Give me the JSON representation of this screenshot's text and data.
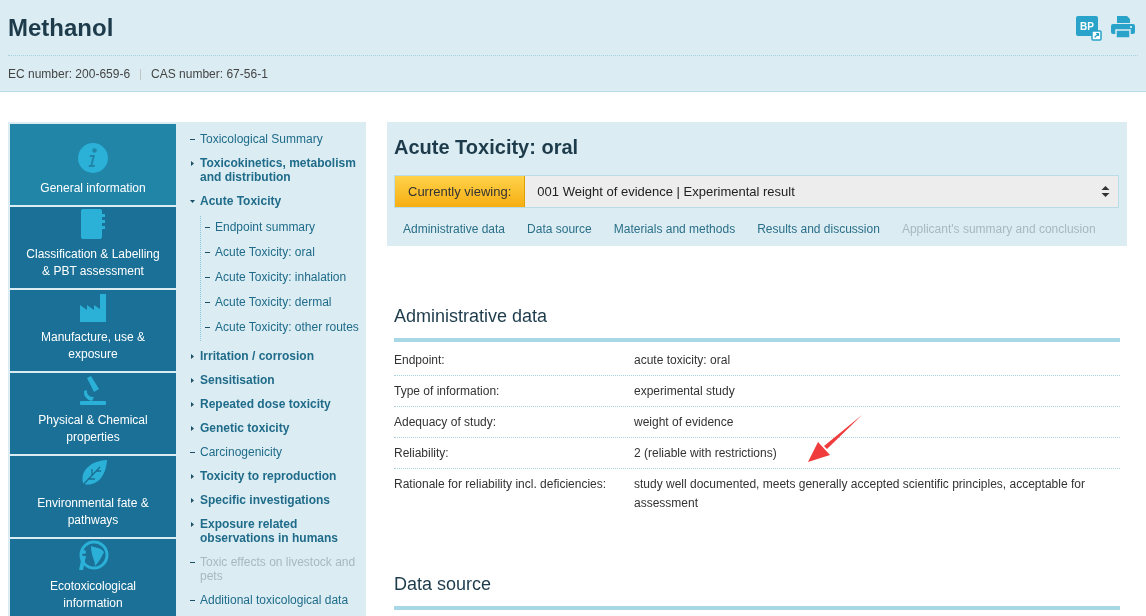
{
  "header": {
    "title": "Methanol",
    "export_badge": "BP",
    "identifiers": [
      {
        "text": "EC number: 200-659-6"
      },
      {
        "text": "CAS number: 67-56-1"
      }
    ]
  },
  "categories": [
    {
      "label": "General information",
      "selected": true
    },
    {
      "label": "Classification & Labelling & PBT assessment",
      "selected": false
    },
    {
      "label": "Manufacture, use & exposure",
      "selected": false
    },
    {
      "label": "Physical & Chemical properties",
      "selected": false
    },
    {
      "label": "Environmental fate & pathways",
      "selected": false
    },
    {
      "label": "Ecotoxicological information",
      "selected": false
    }
  ],
  "tree": [
    {
      "label": "Toxicological Summary",
      "kind": "leaf",
      "disabled": false
    },
    {
      "label": "Toxicokinetics, metabolism and distribution",
      "kind": "branch",
      "expanded": false
    },
    {
      "label": "Acute Toxicity",
      "kind": "branch",
      "expanded": true,
      "children": [
        {
          "label": "Endpoint summary",
          "kind": "leaf",
          "disabled": false
        },
        {
          "label": "Acute Toxicity: oral",
          "kind": "leaf",
          "disabled": false
        },
        {
          "label": "Acute Toxicity: inhalation",
          "kind": "leaf",
          "disabled": false
        },
        {
          "label": "Acute Toxicity: dermal",
          "kind": "leaf",
          "disabled": false
        },
        {
          "label": "Acute Toxicity: other routes",
          "kind": "leaf",
          "disabled": false
        }
      ]
    },
    {
      "label": "Irritation / corrosion",
      "kind": "branch",
      "expanded": false
    },
    {
      "label": "Sensitisation",
      "kind": "branch",
      "expanded": false
    },
    {
      "label": "Repeated dose toxicity",
      "kind": "branch",
      "expanded": false
    },
    {
      "label": "Genetic toxicity",
      "kind": "branch",
      "expanded": false
    },
    {
      "label": "Carcinogenicity",
      "kind": "leaf",
      "disabled": false
    },
    {
      "label": "Toxicity to reproduction",
      "kind": "branch",
      "expanded": false
    },
    {
      "label": "Specific investigations",
      "kind": "branch",
      "expanded": false
    },
    {
      "label": "Exposure related observations in humans",
      "kind": "branch",
      "expanded": false
    },
    {
      "label": "Toxic effects on livestock and pets",
      "kind": "leaf",
      "disabled": true
    },
    {
      "label": "Additional toxicological data",
      "kind": "leaf",
      "disabled": false
    }
  ],
  "panel": {
    "title": "Acute Toxicity: oral",
    "viewing_label": "Currently viewing:",
    "viewing_value": "001 Weight of evidence | Experimental result",
    "tabs": [
      {
        "label": "Administrative data",
        "disabled": false
      },
      {
        "label": "Data source",
        "disabled": false
      },
      {
        "label": "Materials and methods",
        "disabled": false
      },
      {
        "label": "Results and discussion",
        "disabled": false
      },
      {
        "label": "Applicant's summary and conclusion",
        "disabled": true
      }
    ]
  },
  "sections": [
    {
      "heading": "Administrative data",
      "rows": [
        {
          "label": "Endpoint:",
          "value": "acute toxicity: oral"
        },
        {
          "label": "Type of information:",
          "value": "experimental study"
        },
        {
          "label": "Adequacy of study:",
          "value": "weight of evidence"
        },
        {
          "label": "Reliability:",
          "value": "2 (reliable with restrictions)"
        },
        {
          "label": "Rationale for reliability incl. deficiencies:",
          "value": "study well documented, meets generally accepted scientific principles, acceptable for assessment"
        }
      ]
    },
    {
      "heading": "Data source"
    }
  ]
}
